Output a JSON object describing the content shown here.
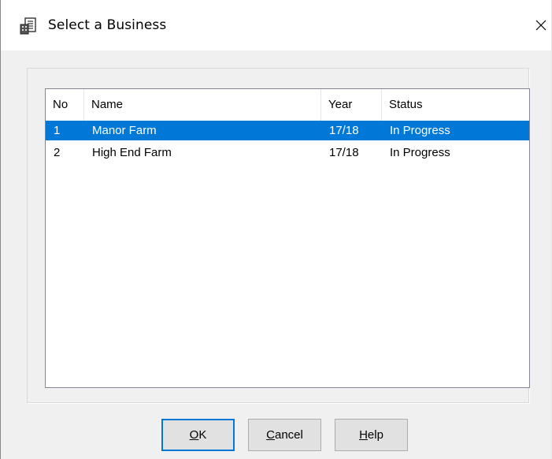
{
  "window": {
    "title": "Select a Business",
    "icon": "business-app-icon",
    "close_icon": "close-icon"
  },
  "list": {
    "columns": [
      "No",
      "Name",
      "Year",
      "Status"
    ],
    "rows": [
      {
        "no": "1",
        "name": "Manor Farm",
        "year": "17/18",
        "status": "In Progress",
        "selected": true
      },
      {
        "no": "2",
        "name": "High End Farm",
        "year": "17/18",
        "status": "In Progress",
        "selected": false
      }
    ],
    "selection_color": "#0078d7"
  },
  "buttons": {
    "ok": {
      "mnemonic": "O",
      "rest": "K"
    },
    "cancel": {
      "mnemonic": "C",
      "rest": "ancel"
    },
    "help": {
      "mnemonic": "H",
      "rest": "elp"
    }
  },
  "colors": {
    "accent": "#0078d7",
    "dialog_bg": "#f0f0f0"
  }
}
